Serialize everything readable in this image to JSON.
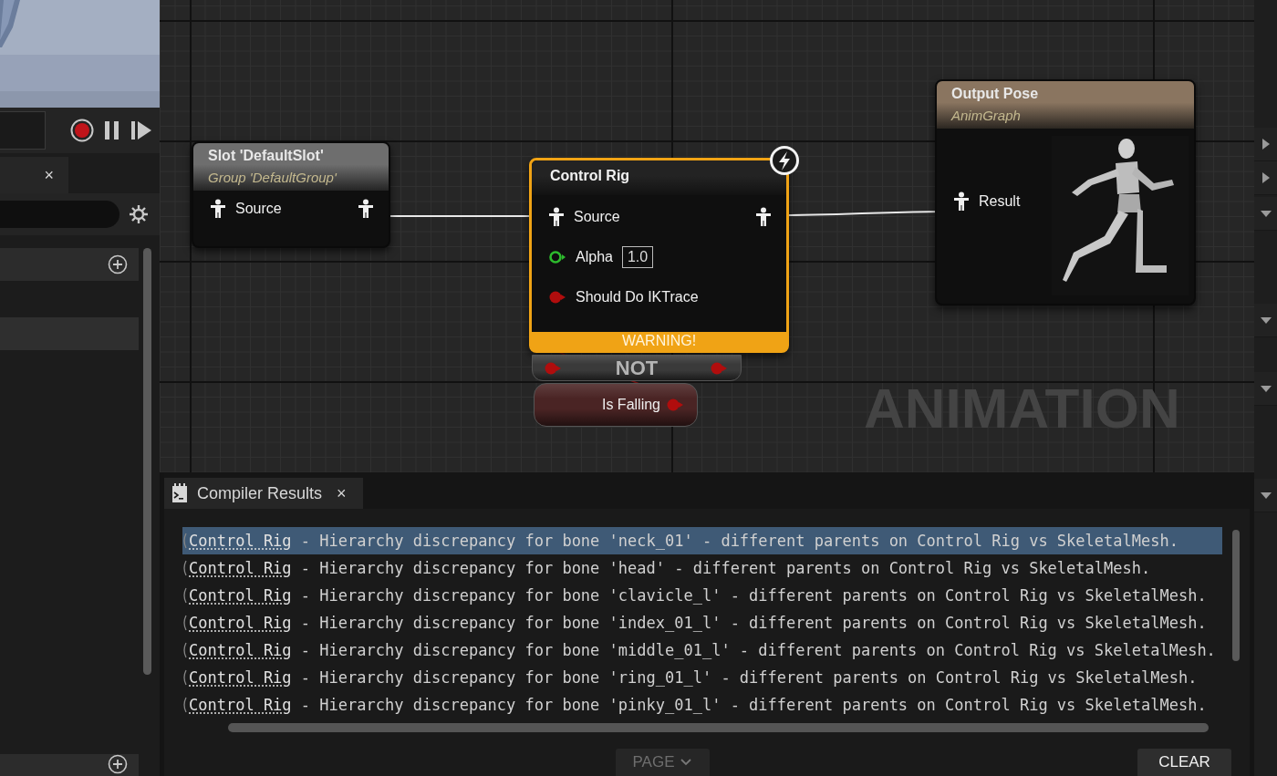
{
  "left_panel": {
    "tab": {
      "close": "×"
    },
    "rows": [
      {
        "selected": true
      }
    ]
  },
  "graph": {
    "nodes": [
      {
        "kind": "node",
        "title": "Slot 'DefaultSlot'",
        "subtitle": "Group 'DefaultGroup'",
        "color": "#6e6e6e",
        "selected": false,
        "pins": [
          {
            "kind": "pose",
            "label": "Source",
            "output": true
          }
        ]
      },
      {
        "kind": "node",
        "title": "Control Rig",
        "color": "#232323",
        "selected": true,
        "fast_path": true,
        "pins": [
          {
            "kind": "pose",
            "label": "Source",
            "output": true
          },
          {
            "kind": "float",
            "label": "Alpha",
            "value": "1.0"
          },
          {
            "kind": "bool",
            "label": "Should Do IKTrace"
          }
        ],
        "warning": "WARNING!"
      },
      {
        "kind": "compact",
        "title": "NOT",
        "color": "#3a3a3a",
        "selected": false,
        "input_pin": {
          "kind": "bool"
        },
        "output_pin": {
          "kind": "bool"
        }
      },
      {
        "kind": "compact",
        "title": "Is Falling",
        "color": "#4a2424",
        "selected": false,
        "output_pin": {
          "kind": "bool"
        }
      },
      {
        "kind": "node",
        "title": "Output Pose",
        "subtitle": "AnimGraph",
        "color": "#8a7560",
        "selected": false,
        "pins": [
          {
            "kind": "pose",
            "label": "Result"
          }
        ]
      }
    ],
    "watermark": "ANIMATION"
  },
  "compiler_results": {
    "tab": {
      "title": "Compiler Results",
      "close": "×"
    },
    "messages": [
      {
        "link": "Control Rig",
        "text": " - Hierarchy discrepancy for bone 'neck_01' - different parents on Control Rig vs SkeletalMesh.",
        "selected": true
      },
      {
        "link": "Control Rig",
        "text": " - Hierarchy discrepancy for bone 'head' - different parents on Control Rig vs SkeletalMesh.",
        "selected": false
      },
      {
        "link": "Control Rig",
        "text": " - Hierarchy discrepancy for bone 'clavicle_l' - different parents on Control Rig vs SkeletalMesh.",
        "selected": false
      },
      {
        "link": "Control Rig",
        "text": " - Hierarchy discrepancy for bone 'index_01_l' - different parents on Control Rig vs SkeletalMesh.",
        "selected": false
      },
      {
        "link": "Control Rig",
        "text": " - Hierarchy discrepancy for bone 'middle_01_l' - different parents on Control Rig vs SkeletalMesh.",
        "selected": false
      },
      {
        "link": "Control Rig",
        "text": " - Hierarchy discrepancy for bone 'ring_01_l' - different parents on Control Rig vs SkeletalMesh.",
        "selected": false
      },
      {
        "link": "Control Rig",
        "text": " - Hierarchy discrepancy for bone 'pinky_01_l' - different parents on Control Rig vs SkeletalMesh.",
        "selected": false
      }
    ],
    "page_button": {
      "label": "PAGE",
      "disabled": true
    },
    "clear_button": {
      "label": "CLEAR",
      "disabled": false
    }
  },
  "right_strip": {
    "toggles": [
      {
        "expanded": false
      },
      {
        "expanded": false
      },
      {
        "expanded": true
      },
      {
        "expanded": true
      },
      {
        "expanded": true
      },
      {
        "expanded": true
      }
    ]
  }
}
